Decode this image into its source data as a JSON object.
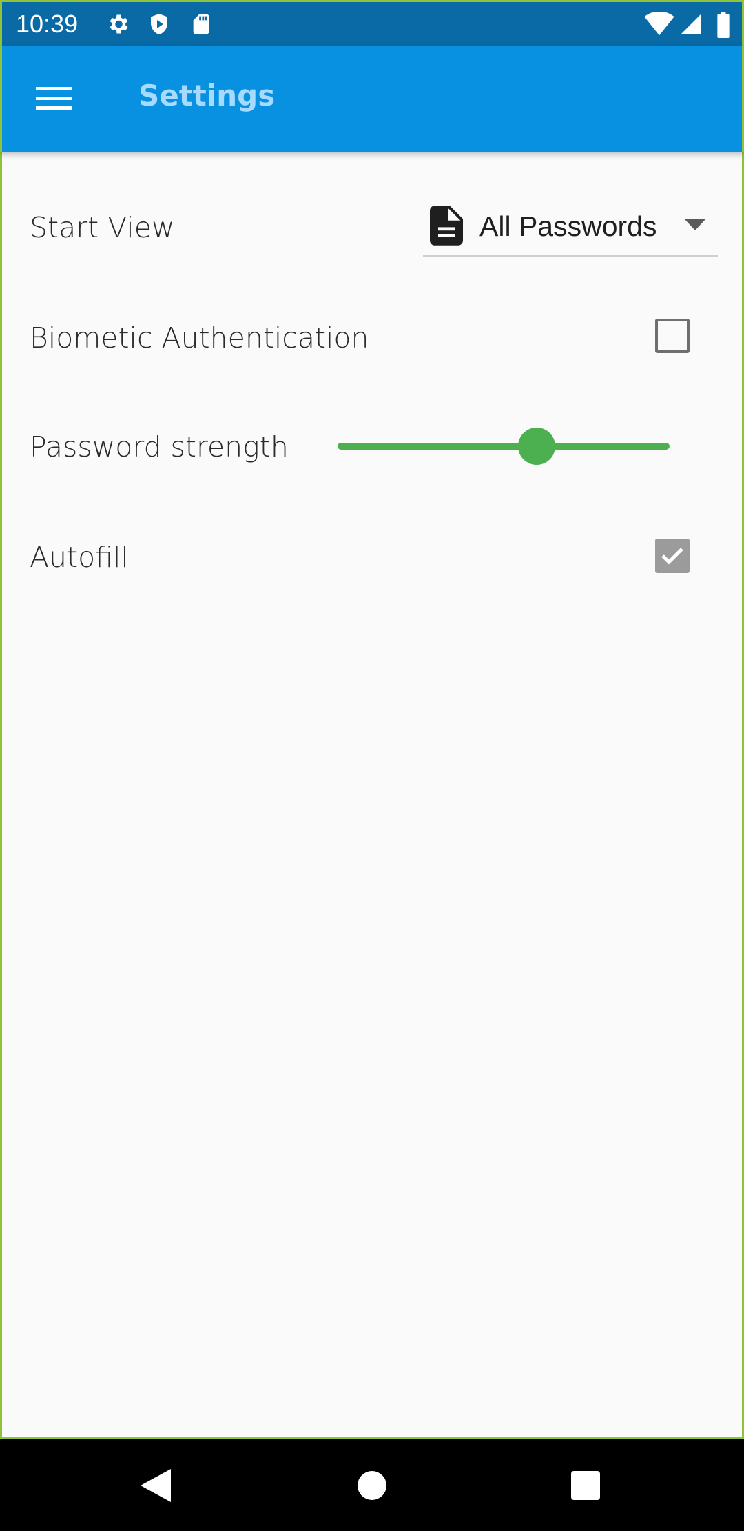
{
  "status_bar": {
    "time": "10:39",
    "left_icons": [
      "gear-icon",
      "shield-icon",
      "sd-card-icon"
    ],
    "right_icons": [
      "wifi-icon",
      "cell-signal-icon",
      "battery-icon"
    ]
  },
  "app_bar": {
    "title": "Settings",
    "menu_icon": "menu-icon",
    "colors": {
      "background": "#0791e0",
      "title": "#a6dbff"
    }
  },
  "settings": {
    "start_view": {
      "label": "Start View",
      "value": "All Passwords",
      "icon": "document-icon"
    },
    "biometric": {
      "label": "Biometic Authentication",
      "checked": false
    },
    "password_strength": {
      "label": "Password strength",
      "value_fraction": 0.6,
      "color": "#4caf50"
    },
    "autofill": {
      "label": "Autofill",
      "checked": true
    }
  },
  "nav_bar": {
    "buttons": [
      "back-icon",
      "home-icon",
      "recents-icon"
    ]
  }
}
